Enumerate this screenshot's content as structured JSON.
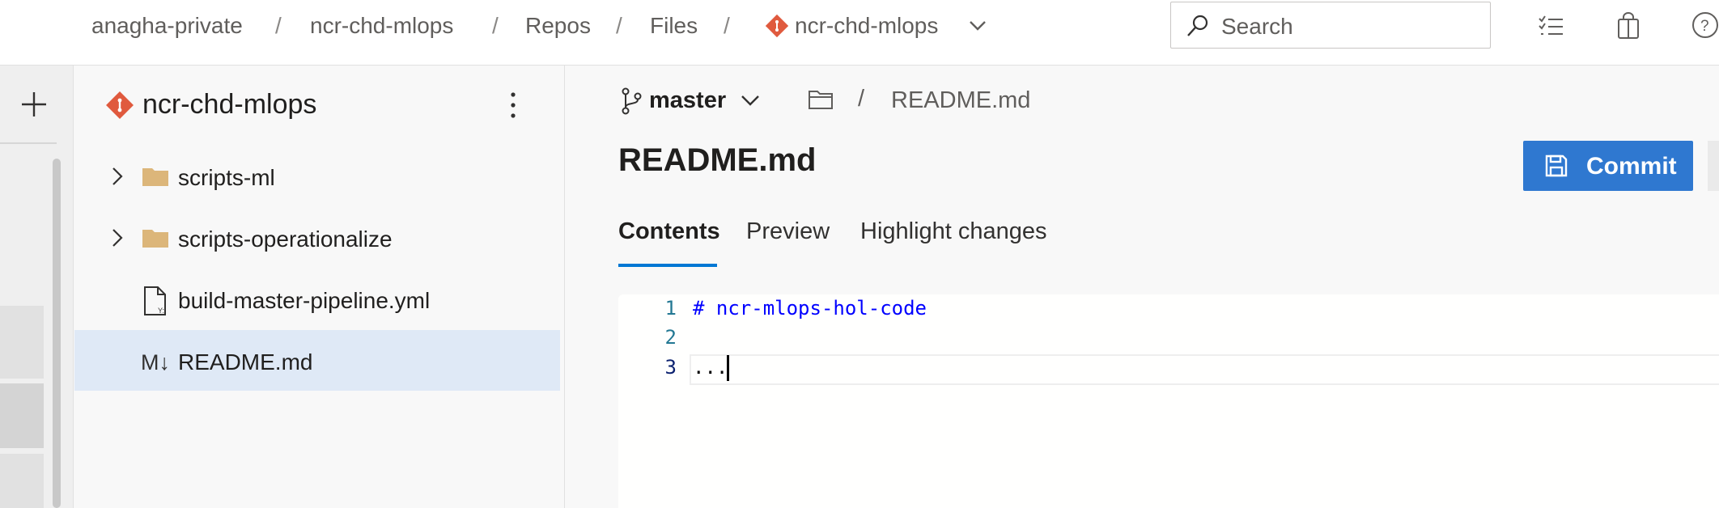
{
  "breadcrumb": {
    "items": [
      "anagha-private",
      "ncr-chd-mlops",
      "Repos",
      "Files",
      "ncr-chd-mlops"
    ],
    "separator": "/"
  },
  "search": {
    "placeholder": "Search"
  },
  "repo": {
    "name": "ncr-chd-mlops"
  },
  "tree": {
    "items": [
      {
        "label": "scripts-ml",
        "icon": "folder-icon"
      },
      {
        "label": "scripts-operationalize",
        "icon": "folder-icon"
      },
      {
        "label": "build-master-pipeline.yml",
        "icon": "yaml-file-icon"
      },
      {
        "label": "README.md",
        "icon": "markdown-icon",
        "markdown_glyph": "M↓"
      }
    ]
  },
  "branch": {
    "name": "master"
  },
  "path": {
    "separator": "/",
    "file": "README.md"
  },
  "file": {
    "title": "README.md"
  },
  "toolbar": {
    "commit_label": "Commit"
  },
  "tabs": [
    "Contents",
    "Preview",
    "Highlight changes"
  ],
  "editor": {
    "lines": [
      {
        "number": "1",
        "text": "# ncr-mlops-hol-code"
      },
      {
        "number": "2",
        "text": ""
      },
      {
        "number": "3",
        "text": "..."
      }
    ]
  },
  "colors": {
    "accent": "#0078d4",
    "commit_button": "#2f78d0",
    "git_logo": "#e05a3e",
    "folder": "#dcb67a",
    "selected_row": "#dfe9f6",
    "heading_code": "#0000ff"
  }
}
